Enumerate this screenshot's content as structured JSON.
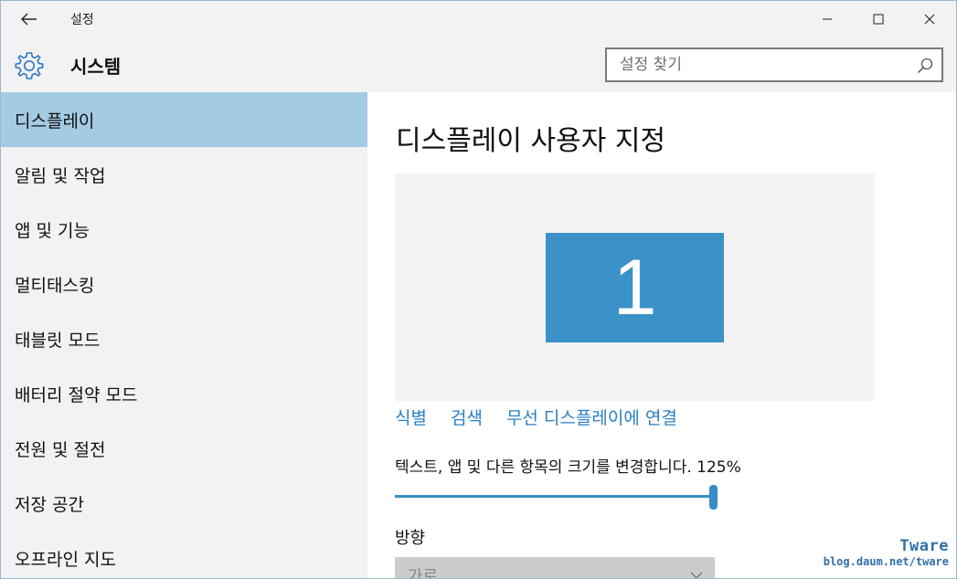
{
  "window": {
    "title": "설정",
    "back_icon": "back-arrow-icon",
    "controls": [
      "minimize-icon",
      "maximize-icon",
      "close-icon"
    ]
  },
  "header": {
    "icon": "gear-icon",
    "title": "시스템",
    "search": {
      "placeholder": "설정 찾기",
      "value": "",
      "icon": "search-icon"
    }
  },
  "sidebar": {
    "items": [
      {
        "label": "디스플레이",
        "active": true
      },
      {
        "label": "알림 및 작업",
        "active": false
      },
      {
        "label": "앱 및 기능",
        "active": false
      },
      {
        "label": "멀티태스킹",
        "active": false
      },
      {
        "label": "태블릿 모드",
        "active": false
      },
      {
        "label": "배터리 절약 모드",
        "active": false
      },
      {
        "label": "전원 및 절전",
        "active": false
      },
      {
        "label": "저장 공간",
        "active": false
      },
      {
        "label": "오프라인 지도",
        "active": false
      }
    ]
  },
  "main": {
    "title": "디스플레이 사용자 지정",
    "monitor_label": "1",
    "links": {
      "identify": "식별",
      "detect": "검색",
      "wireless": "무선 디스플레이에 연결"
    },
    "scale": {
      "label": "텍스트, 앱 및 다른 항목의 크기를 변경합니다. 125%",
      "level_fraction": 1.0
    },
    "orientation": {
      "label": "방향",
      "value": "가로",
      "icon": "chevron-down-icon"
    }
  },
  "watermark": {
    "name": "Tware",
    "url": "blog.daum.net/tware"
  },
  "colors": {
    "accent": "#3a92c8",
    "sidebar_active": "#a3cbe3",
    "link": "#2a7fc4",
    "left_bg": "#f2f2f2"
  }
}
